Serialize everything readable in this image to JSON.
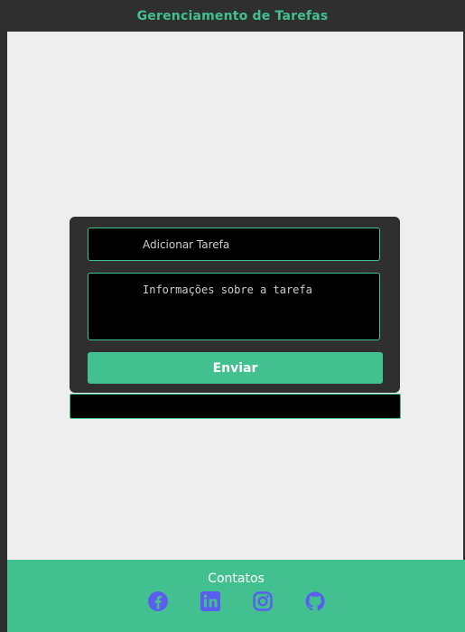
{
  "header": {
    "title": "Gerenciamento de Tarefas"
  },
  "form": {
    "title_placeholder": "Adicionar Tarefa",
    "info_placeholder": "Informações sobre a tarefa",
    "submit_label": "Enviar"
  },
  "footer": {
    "title": "Contatos",
    "icons": [
      "facebook-icon",
      "linkedin-icon",
      "instagram-icon",
      "github-icon"
    ]
  },
  "colors": {
    "accent": "#42c08f",
    "icon": "#5b5cf0",
    "header_bg": "#2f2f2f",
    "content_bg": "#eeeeee",
    "field_bg": "#000000"
  }
}
